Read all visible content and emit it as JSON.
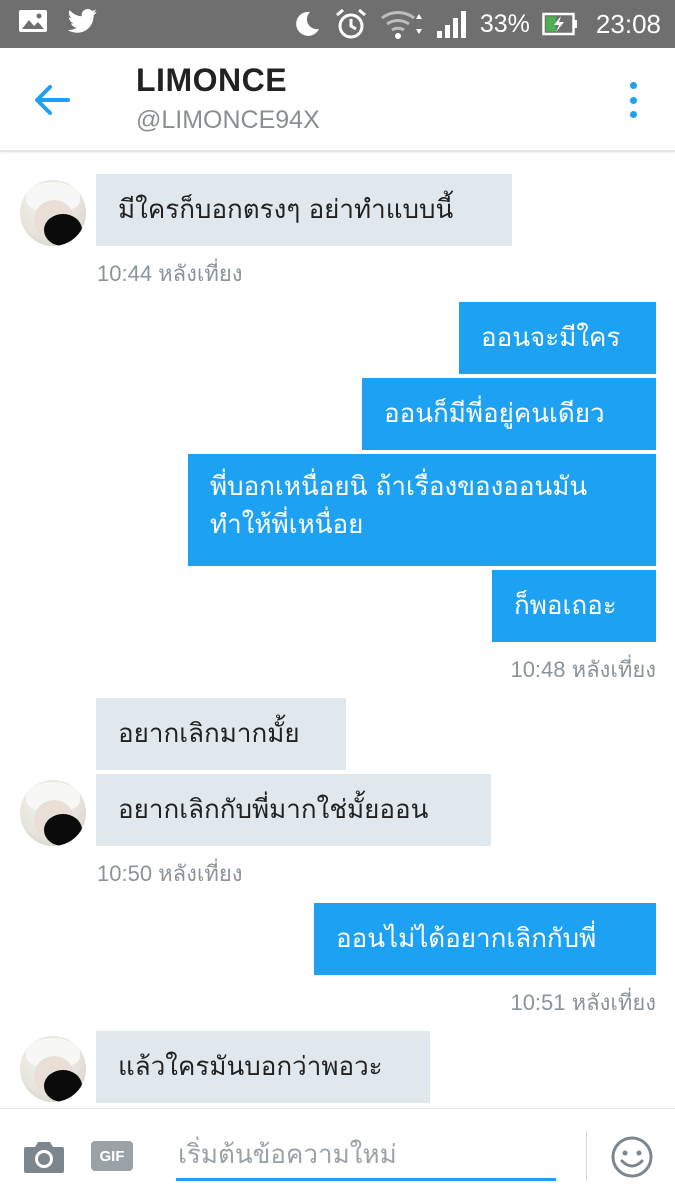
{
  "status_bar": {
    "battery": "33%",
    "time": "23:08"
  },
  "header": {
    "name": "LIMONCE",
    "handle": "@LIMONCE94X"
  },
  "messages": [
    {
      "text": "มีใครก็บอกตรงๆ อย่าทำแบบนี้"
    },
    {
      "text": "ออนจะมีใคร"
    },
    {
      "text": "ออนก็มีพี่อยู่คนเดียว"
    },
    {
      "text": "พี่บอกเหนื่อยนิ ถ้าเรื่องของออนมัน ทำให้พี่เหนื่อย"
    },
    {
      "text": "ก็พอเถอะ"
    },
    {
      "text": "อยากเลิกมากมั้ย"
    },
    {
      "text": "อยากเลิกกับพี่มากใช่มั้ยออน"
    },
    {
      "text": "ออนไม่ได้อยากเลิกกับพี่"
    },
    {
      "text": "แล้วใครมันบอกว่าพอวะ"
    }
  ],
  "timestamps": [
    "10:44 หลังเที่ยง",
    "10:48 หลังเที่ยง",
    "10:50 หลังเที่ยง",
    "10:51 หลังเที่ยง"
  ],
  "composer": {
    "placeholder": "เริ่มต้นข้อความใหม่",
    "gif_label": "GIF"
  },
  "colors": {
    "accent": "#1da1f2",
    "incoming_bubble": "#e1e8ed",
    "status_bar": "#6f6f6f"
  },
  "icons": [
    "gallery-icon",
    "twitter-bird-icon",
    "moon-icon",
    "alarm-icon",
    "wifi-icon",
    "signal-icon",
    "battery-charging-icon",
    "back-arrow-icon",
    "more-vertical-icon",
    "camera-icon",
    "emoji-icon"
  ]
}
